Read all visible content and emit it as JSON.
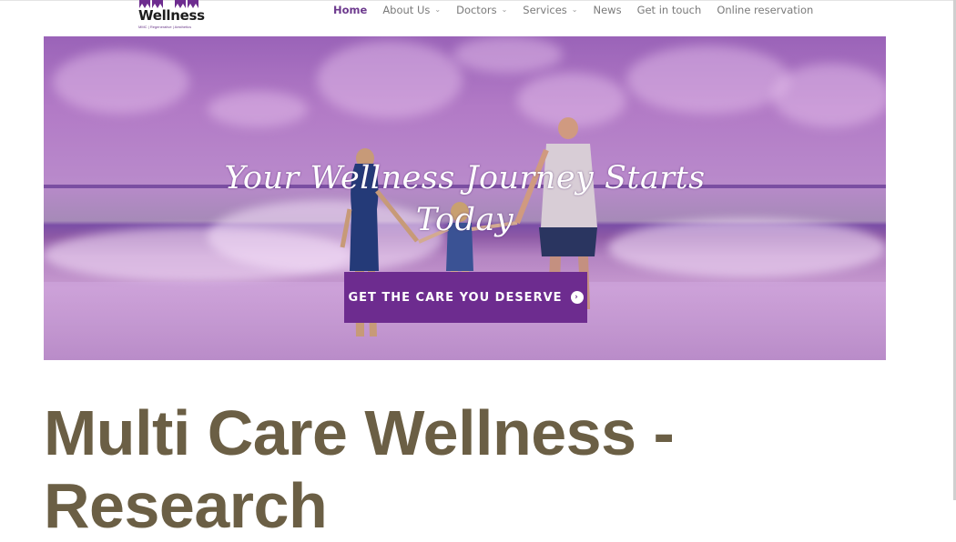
{
  "logo": {
    "title": "Wellness",
    "tagline": "MMC | Regenerative | Aesthetics"
  },
  "nav": {
    "items": [
      {
        "label": "Home",
        "active": true
      },
      {
        "label": "About Us",
        "dropdown": true
      },
      {
        "label": "Doctors",
        "dropdown": true
      },
      {
        "label": "Services",
        "dropdown": true
      },
      {
        "label": "News"
      },
      {
        "label": "Get in touch"
      },
      {
        "label": "Online reservation"
      }
    ],
    "caret": "⌄"
  },
  "hero": {
    "headline_line1": "Your Wellness Journey Starts",
    "headline_line2": "Today",
    "cta_label": "GET THE CARE YOU DESERVE",
    "cta_icon": "›"
  },
  "main": {
    "title": "Multi Care Wellness - Research"
  },
  "colors": {
    "accent": "#6d2c8f",
    "title": "#6b5f45",
    "nav_active": "#6d3a8e"
  }
}
